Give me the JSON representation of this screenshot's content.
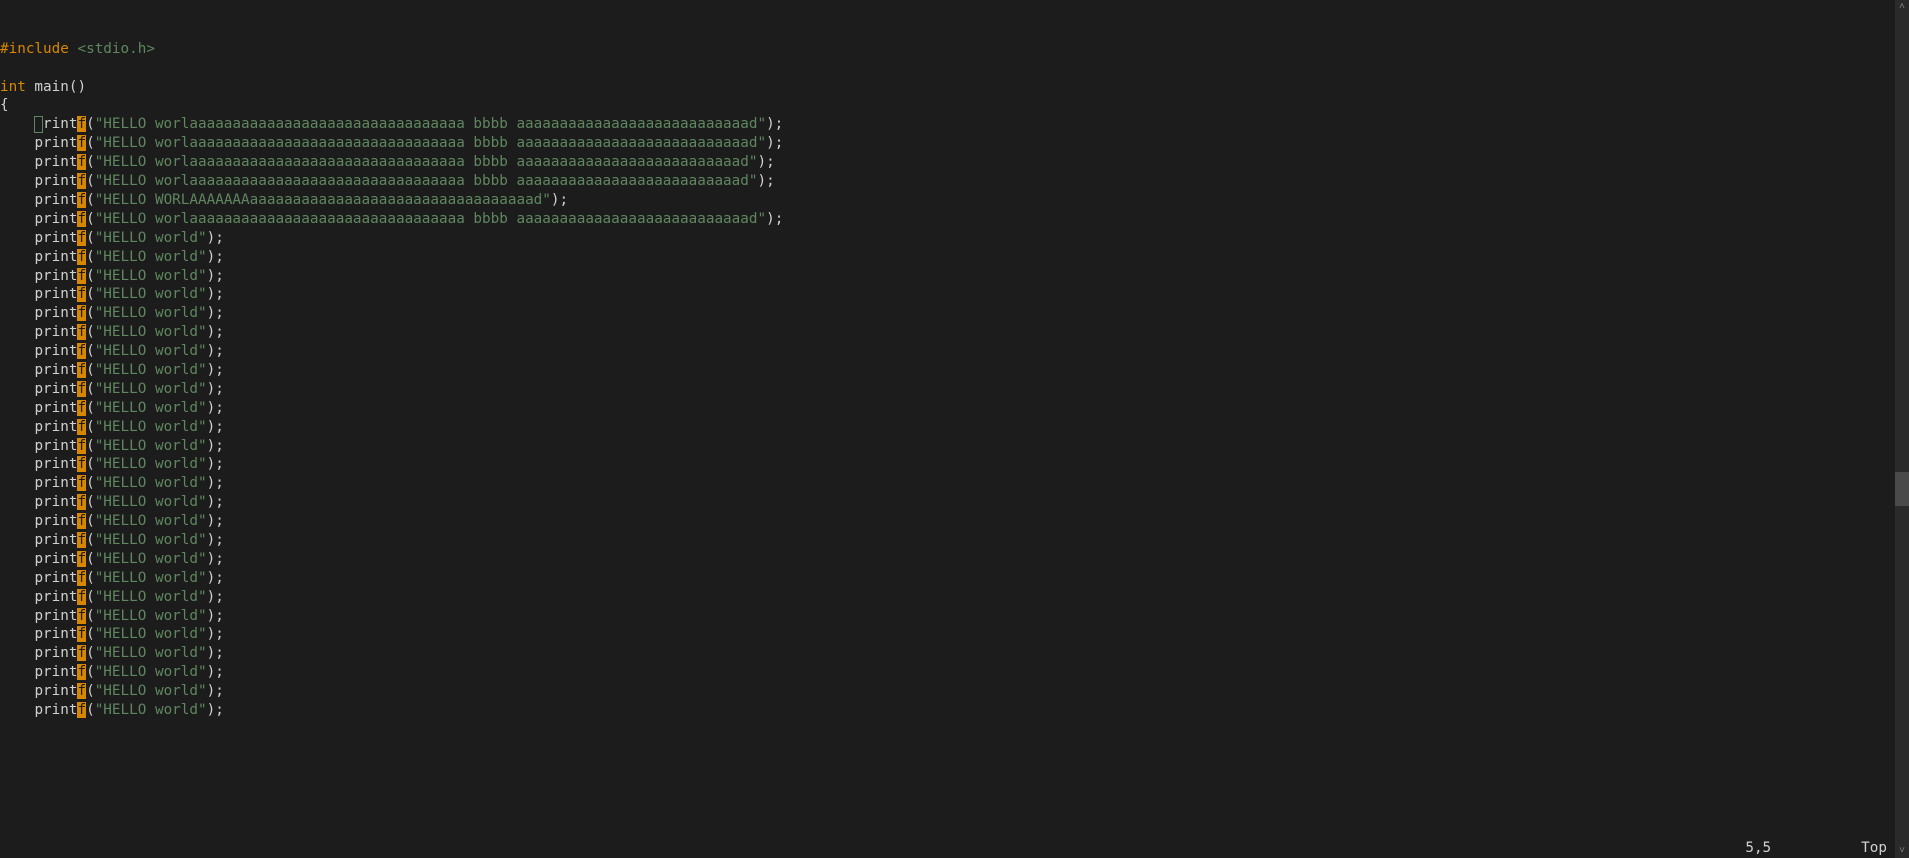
{
  "include_directive": "#include",
  "include_header": " <stdio.h>",
  "type_int": "int",
  "fn_main": " main()",
  "brace_open": "{",
  "printf_prefix": "print",
  "colchar": "f",
  "paren_open": "(",
  "paren_close_semi": ");",
  "long_lines": [
    "\"HELLO worlaaaaaaaaaaaaaaaaaaaaaaaaaaaaaaaa bbbb aaaaaaaaaaaaaaaaaaaaaaaaaaad\"",
    "\"HELLO worlaaaaaaaaaaaaaaaaaaaaaaaaaaaaaaaa bbbb aaaaaaaaaaaaaaaaaaaaaaaaaaad\"",
    "\"HELLO worlaaaaaaaaaaaaaaaaaaaaaaaaaaaaaaaa bbbb aaaaaaaaaaaaaaaaaaaaaaaaaad\"",
    "\"HELLO worlaaaaaaaaaaaaaaaaaaaaaaaaaaaaaaaa bbbb aaaaaaaaaaaaaaaaaaaaaaaaaad\"",
    "\"HELLO WORLAAAAAAAaaaaaaaaaaaaaaaaaaaaaaaaaaaaaaaaad\"",
    "\"HELLO worlaaaaaaaaaaaaaaaaaaaaaaaaaaaaaaaa bbbb aaaaaaaaaaaaaaaaaaaaaaaaaaad\""
  ],
  "short_str": "\"HELLO world\"",
  "short_count": 26,
  "status_pos": "5,5",
  "status_loc": "Top",
  "scrollbar_up": "˄",
  "scrollbar_down": "˅",
  "thumb_top_pct": 55,
  "thumb_h_pct": 4
}
